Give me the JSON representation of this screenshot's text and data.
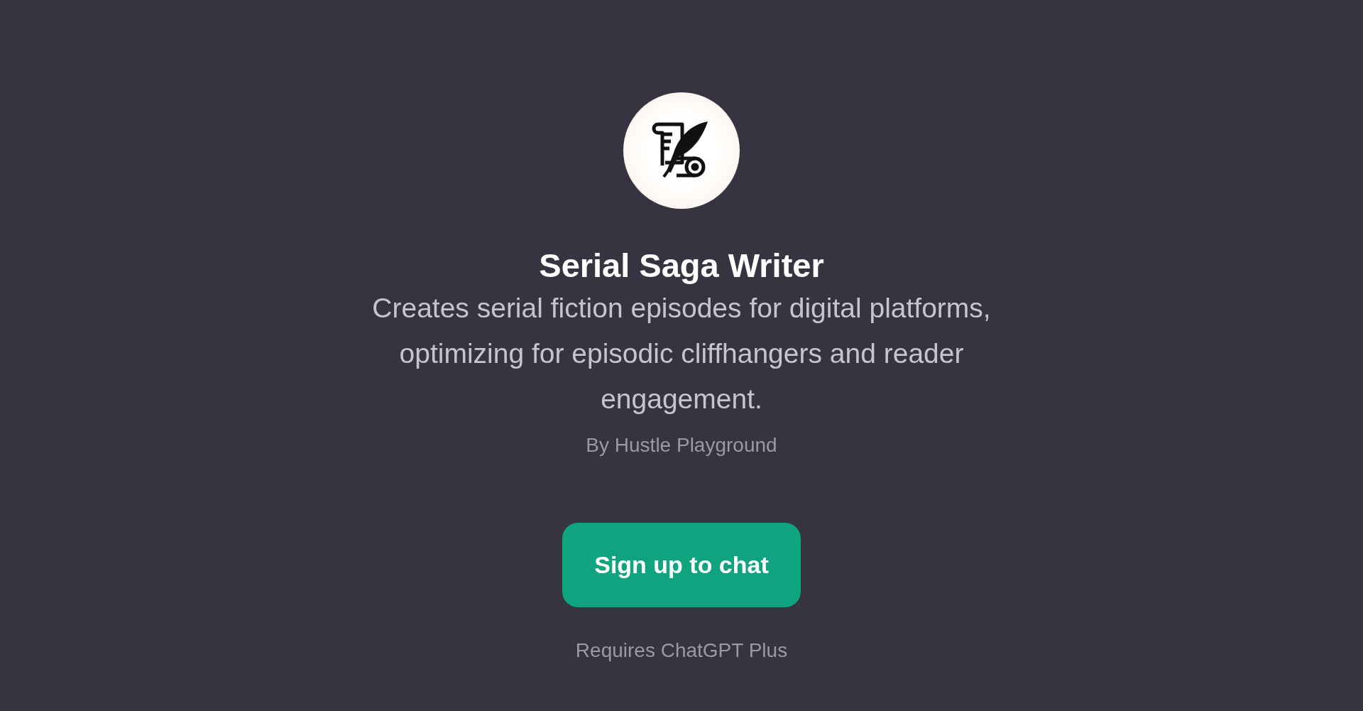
{
  "gpt": {
    "name": "Serial Saga Writer",
    "description": "Creates serial fiction episodes for digital platforms, optimizing for episodic cliffhangers and reader engagement.",
    "author": "By Hustle Playground"
  },
  "cta": {
    "label": "Sign up to chat"
  },
  "note": "Requires ChatGPT Plus"
}
